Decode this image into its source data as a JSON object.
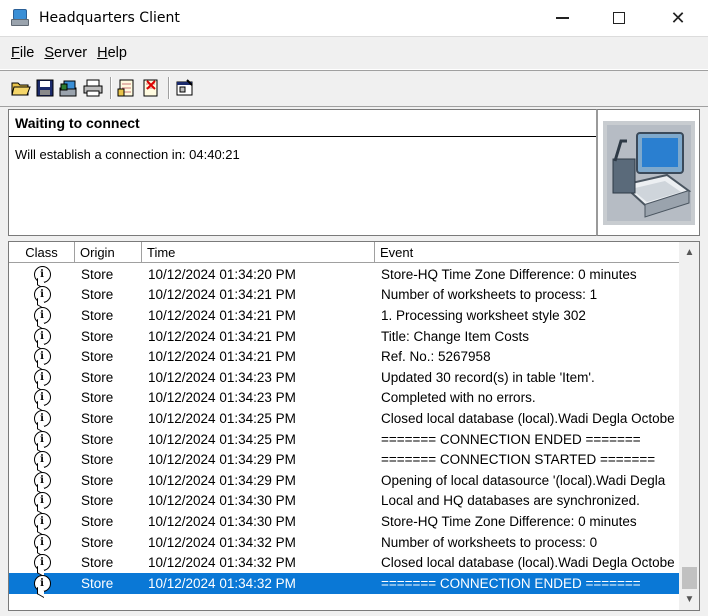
{
  "window": {
    "title": "Headquarters Client"
  },
  "menu": [
    {
      "prefix": "",
      "accel": "F",
      "rest": "ile"
    },
    {
      "prefix": "",
      "accel": "S",
      "rest": "erver"
    },
    {
      "prefix": "",
      "accel": "H",
      "rest": "elp"
    }
  ],
  "toolbar": {
    "icons": [
      "open-folder-icon",
      "save-icon",
      "connect-icon",
      "print-icon",
      "worksheet-icon",
      "delete-worksheet-icon",
      "properties-icon"
    ]
  },
  "status": {
    "heading": "Waiting to connect",
    "message": "Will establish a connection in: 04:40:21"
  },
  "list": {
    "columns": [
      "Class",
      "Origin",
      "Time",
      "Event"
    ],
    "rows": [
      {
        "origin": "Store",
        "time": "10/12/2024 01:34:20 PM",
        "event": "Store-HQ Time Zone Difference: 0 minutes"
      },
      {
        "origin": "Store",
        "time": "10/12/2024 01:34:21 PM",
        "event": "Number of worksheets to process: 1"
      },
      {
        "origin": "Store",
        "time": "10/12/2024 01:34:21 PM",
        "event": "1. Processing worksheet style 302"
      },
      {
        "origin": "Store",
        "time": "10/12/2024 01:34:21 PM",
        "event": "Title: Change Item Costs"
      },
      {
        "origin": "Store",
        "time": "10/12/2024 01:34:21 PM",
        "event": "Ref. No.: 5267958"
      },
      {
        "origin": "Store",
        "time": "10/12/2024 01:34:23 PM",
        "event": "Updated 30 record(s) in table 'Item'."
      },
      {
        "origin": "Store",
        "time": "10/12/2024 01:34:23 PM",
        "event": "Completed with no errors."
      },
      {
        "origin": "Store",
        "time": "10/12/2024 01:34:25 PM",
        "event": "Closed local database (local).Wadi Degla Octobe"
      },
      {
        "origin": "Store",
        "time": "10/12/2024 01:34:25 PM",
        "event": "======= CONNECTION ENDED ======="
      },
      {
        "origin": "Store",
        "time": "10/12/2024 01:34:29 PM",
        "event": "======= CONNECTION STARTED ======="
      },
      {
        "origin": "Store",
        "time": "10/12/2024 01:34:29 PM",
        "event": "Opening of local datasource '(local).Wadi Degla"
      },
      {
        "origin": "Store",
        "time": "10/12/2024 01:34:30 PM",
        "event": "Local and HQ databases are synchronized."
      },
      {
        "origin": "Store",
        "time": "10/12/2024 01:34:30 PM",
        "event": "Store-HQ Time Zone Difference: 0 minutes"
      },
      {
        "origin": "Store",
        "time": "10/12/2024 01:34:32 PM",
        "event": "Number of worksheets to process: 0"
      },
      {
        "origin": "Store",
        "time": "10/12/2024 01:34:32 PM",
        "event": "Closed local database (local).Wadi Degla Octobe"
      },
      {
        "origin": "Store",
        "time": "10/12/2024 01:34:32 PM",
        "event": "======= CONNECTION ENDED =======",
        "selected": true
      }
    ]
  },
  "colors": {
    "selection": "#0a78d6",
    "window_bg": "#f0f0f0"
  }
}
